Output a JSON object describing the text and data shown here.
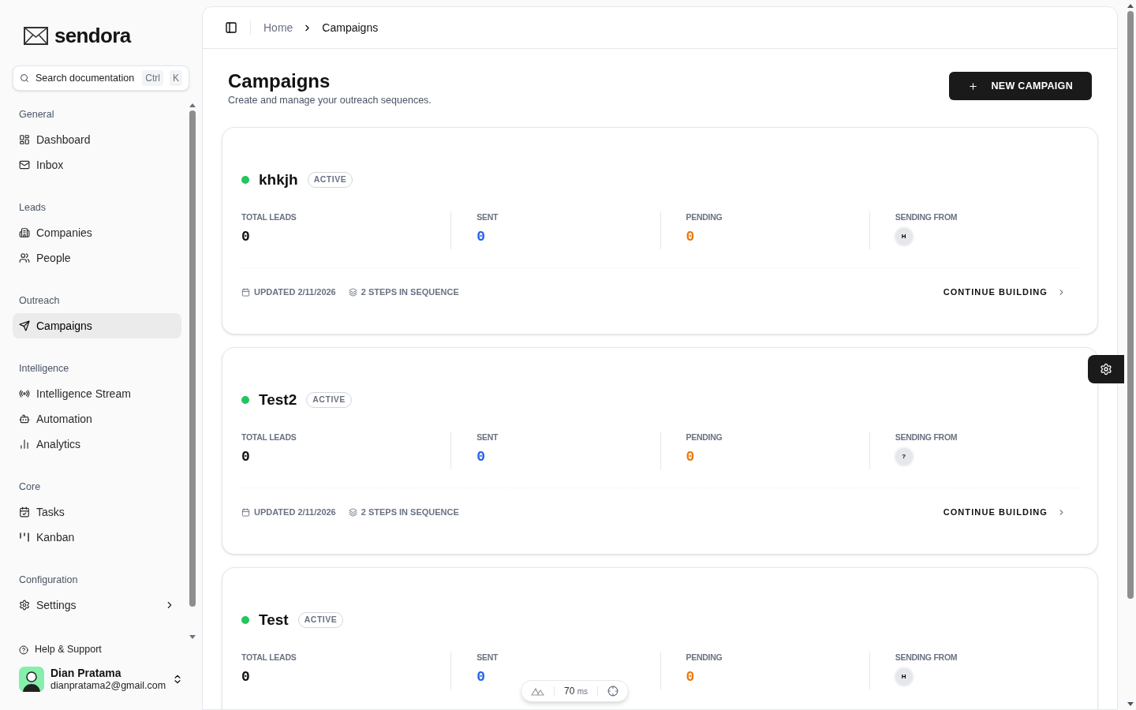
{
  "brand": {
    "name": "sendora"
  },
  "search": {
    "placeholder": "Search documentation",
    "keys": [
      "Ctrl",
      "K"
    ]
  },
  "nav_sections": [
    {
      "title": "General",
      "items": [
        {
          "label": "Dashboard",
          "selected": false,
          "expandable": false
        },
        {
          "label": "Inbox",
          "selected": false,
          "expandable": false
        }
      ]
    },
    {
      "title": "Leads",
      "items": [
        {
          "label": "Companies",
          "selected": false,
          "expandable": false
        },
        {
          "label": "People",
          "selected": false,
          "expandable": false
        }
      ]
    },
    {
      "title": "Outreach",
      "items": [
        {
          "label": "Campaigns",
          "selected": true,
          "expandable": false
        }
      ]
    },
    {
      "title": "Intelligence",
      "items": [
        {
          "label": "Intelligence Stream",
          "selected": false,
          "expandable": false
        },
        {
          "label": "Automation",
          "selected": false,
          "expandable": false
        },
        {
          "label": "Analytics",
          "selected": false,
          "expandable": false
        }
      ]
    },
    {
      "title": "Core",
      "items": [
        {
          "label": "Tasks",
          "selected": false,
          "expandable": false
        },
        {
          "label": "Kanban",
          "selected": false,
          "expandable": false
        }
      ]
    },
    {
      "title": "Configuration",
      "items": [
        {
          "label": "Settings",
          "selected": false,
          "expandable": true
        }
      ]
    }
  ],
  "help": {
    "label": "Help & Support"
  },
  "user": {
    "name": "Dian Pratama",
    "email": "dianpratama2@gmail.com"
  },
  "breadcrumb": [
    "Home",
    "Campaigns"
  ],
  "page": {
    "title": "Campaigns",
    "subtitle": "Create and manage your outreach sequences.",
    "new_button": "NEW CAMPAIGN"
  },
  "campaigns": [
    {
      "name": "khkjh",
      "status": "ACTIVE",
      "color": "#22c55e",
      "stats": [
        {
          "label": "TOTAL LEADS",
          "value": "0",
          "color": "#111111"
        },
        {
          "label": "SENT",
          "value": "0",
          "color": "#2563eb"
        },
        {
          "label": "PENDING",
          "value": "0",
          "color": "#ea7a0c"
        }
      ],
      "sending_from": {
        "label": "SENDING FROM",
        "initial": "H"
      },
      "updated": "UPDATED 2/11/2026",
      "steps": "2 STEPS IN SEQUENCE",
      "action": "CONTINUE BUILDING"
    },
    {
      "name": "Test2",
      "status": "ACTIVE",
      "color": "#22c55e",
      "stats": [
        {
          "label": "TOTAL LEADS",
          "value": "0",
          "color": "#111111"
        },
        {
          "label": "SENT",
          "value": "0",
          "color": "#2563eb"
        },
        {
          "label": "PENDING",
          "value": "0",
          "color": "#ea7a0c"
        }
      ],
      "sending_from": {
        "label": "SENDING FROM",
        "initial": "?"
      },
      "updated": "UPDATED 2/11/2026",
      "steps": "2 STEPS IN SEQUENCE",
      "action": "CONTINUE BUILDING"
    },
    {
      "name": "Test",
      "status": "ACTIVE",
      "color": "#22c55e",
      "stats": [
        {
          "label": "TOTAL LEADS",
          "value": "0",
          "color": "#111111"
        },
        {
          "label": "SENT",
          "value": "0",
          "color": "#2563eb"
        },
        {
          "label": "PENDING",
          "value": "0",
          "color": "#ea7a0c"
        }
      ],
      "sending_from": {
        "label": "SENDING FROM",
        "initial": "H"
      }
    }
  ],
  "perf": {
    "value": "70",
    "unit": "ms"
  }
}
